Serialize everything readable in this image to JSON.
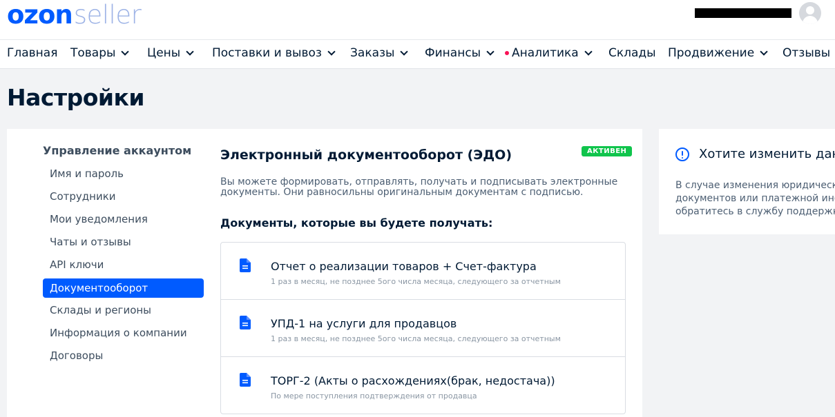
{
  "header": {
    "logo_bold": "ozon",
    "logo_light": "seller"
  },
  "topnav": [
    {
      "label": "Главная",
      "chevron": false,
      "dot": false
    },
    {
      "label": "Товары",
      "chevron": true,
      "dot": false
    },
    {
      "label": "Цены",
      "chevron": true,
      "dot": false
    },
    {
      "label": "Поставки и вывоз",
      "chevron": true,
      "dot": false
    },
    {
      "label": "Заказы",
      "chevron": true,
      "dot": false
    },
    {
      "label": "Финансы",
      "chevron": true,
      "dot": false
    },
    {
      "label": "Аналитика",
      "chevron": true,
      "dot": true
    },
    {
      "label": "Склады",
      "chevron": false,
      "dot": false
    },
    {
      "label": "Продвижение",
      "chevron": true,
      "dot": false
    },
    {
      "label": "Отзывы",
      "chevron": false,
      "dot": false
    }
  ],
  "page": {
    "title": "Настройки"
  },
  "sidebar": {
    "heading": "Управление аккаунтом",
    "items": [
      {
        "label": "Имя и пароль",
        "active": false
      },
      {
        "label": "Сотрудники",
        "active": false
      },
      {
        "label": "Мои уведомления",
        "active": false
      },
      {
        "label": "Чаты и отзывы",
        "active": false
      },
      {
        "label": "API ключи",
        "active": false
      },
      {
        "label": "Документооборот",
        "active": true
      },
      {
        "label": "Склады и регионы",
        "active": false
      },
      {
        "label": "Информация о компании",
        "active": false
      },
      {
        "label": "Договоры",
        "active": false
      }
    ]
  },
  "edo": {
    "title": "Электронный документооборот (ЭДО)",
    "status_badge": "АКТИВЕН",
    "description": "Вы можете формировать, отправлять, получать и подписывать электронные документы. Они равносильны оригинальным документам с подписью.",
    "documents_heading": "Документы, которые вы будете получать:",
    "documents": [
      {
        "title": "Отчет о реализации товаров + Счет-фактура",
        "subtitle": "1 раз в месяц, не позднее 5ого числа месяца, следующего за отчетным",
        "icon": "document-icon"
      },
      {
        "title": "УПД-1 на услуги для продавцов",
        "subtitle": "1 раз в месяц, не позднее 5ого числа месяца, следующего за отчетным",
        "icon": "document-icon"
      },
      {
        "title": "ТОРГ-2 (Акты о расхождениях(брак, недостача))",
        "subtitle": "По мере поступления подтверждения от продавца",
        "icon": "document-icon"
      }
    ]
  },
  "info_card": {
    "title": "Хотите изменить дан",
    "text": "В случае изменения юридическо\nдокументов или платежной инфо\nобратитесь в службу поддержки"
  },
  "colors": {
    "brand": "#005bff",
    "active_badge": "#10c44c",
    "notification_dot": "#f91155"
  }
}
